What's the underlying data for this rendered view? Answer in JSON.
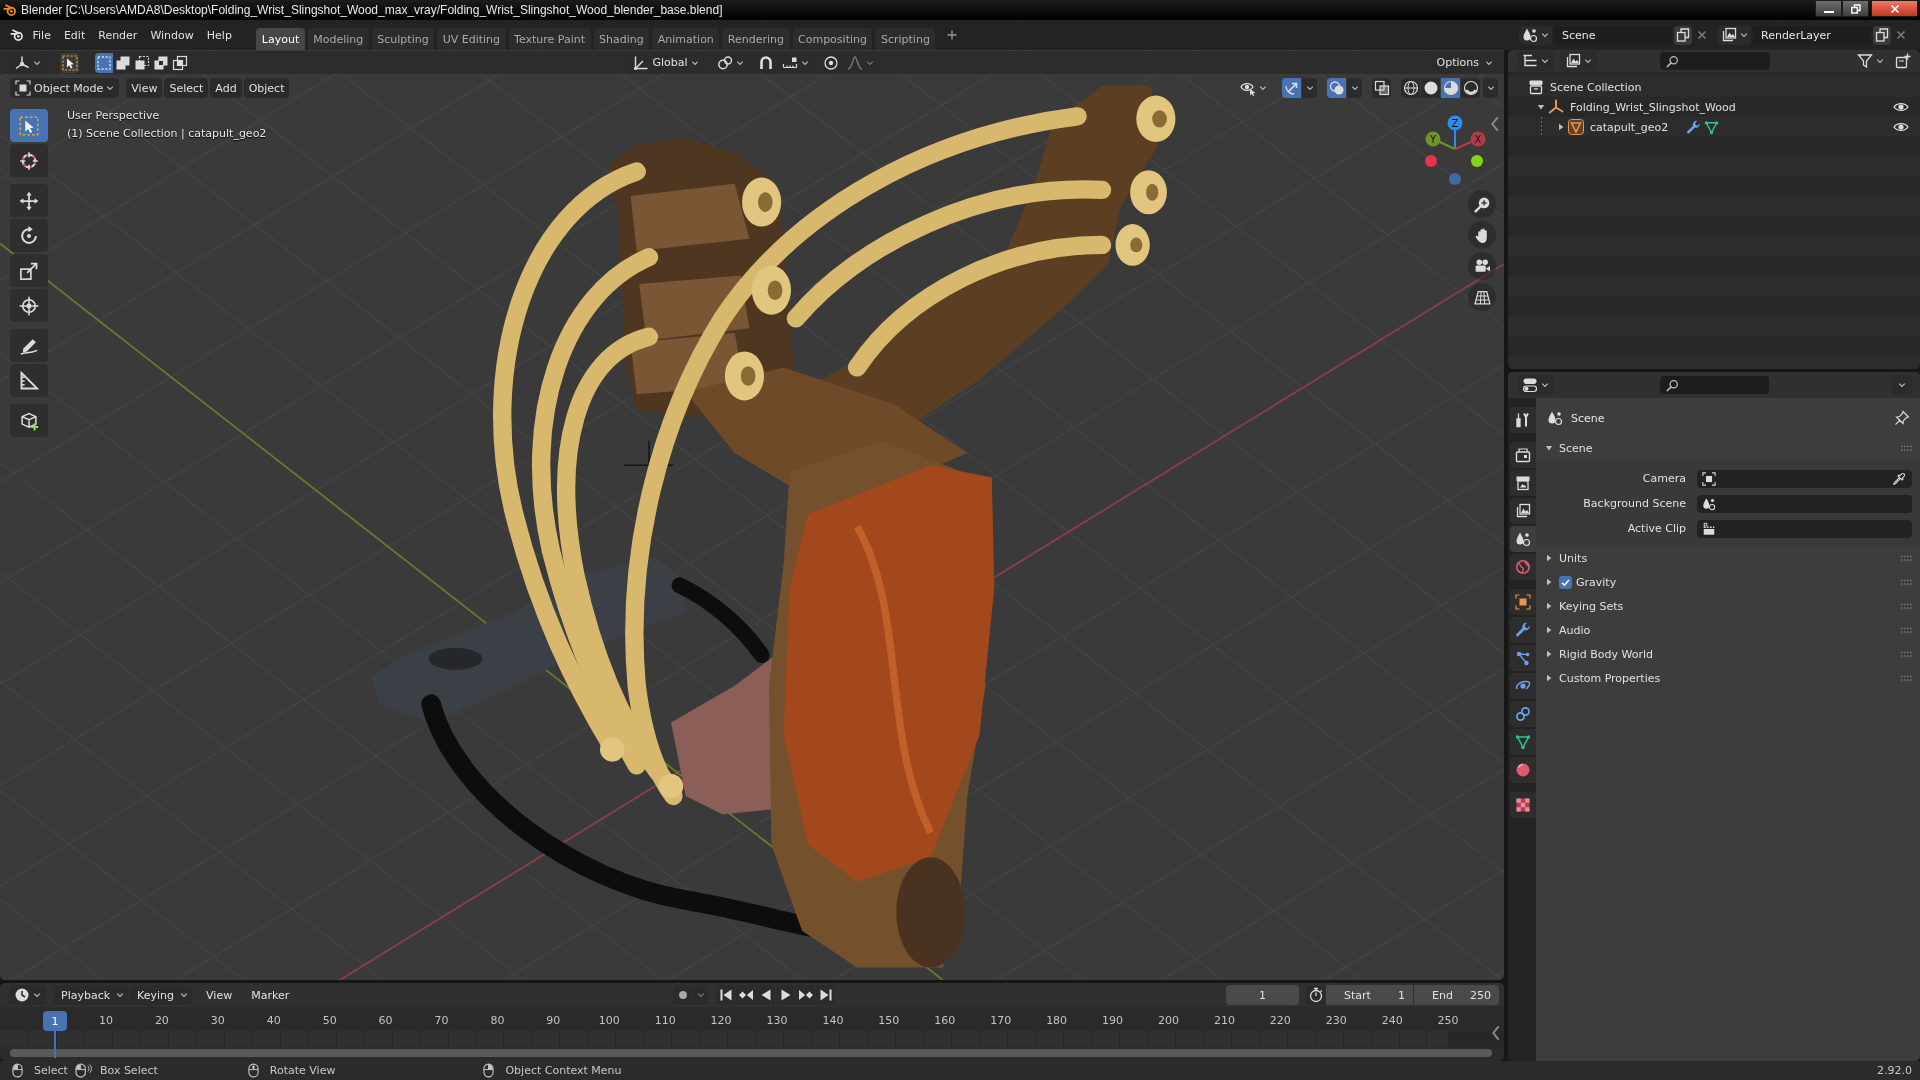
{
  "window": {
    "title": "Blender [C:\\Users\\AMDA8\\Desktop\\Folding_Wrist_Slingshot_Wood_max_vray/Folding_Wrist_Slingshot_Wood_blender_base.blend]"
  },
  "menu": [
    "File",
    "Edit",
    "Render",
    "Window",
    "Help"
  ],
  "workspaces": [
    {
      "label": "Layout",
      "selected": true
    },
    {
      "label": "Modeling",
      "selected": false
    },
    {
      "label": "Sculpting",
      "selected": false
    },
    {
      "label": "UV Editing",
      "selected": false
    },
    {
      "label": "Texture Paint",
      "selected": false
    },
    {
      "label": "Shading",
      "selected": false
    },
    {
      "label": "Animation",
      "selected": false
    },
    {
      "label": "Rendering",
      "selected": false
    },
    {
      "label": "Compositing",
      "selected": false
    },
    {
      "label": "Scripting",
      "selected": false
    }
  ],
  "scene": {
    "value": "Scene"
  },
  "view_layer": {
    "value": "RenderLayer"
  },
  "tool_header": {
    "select_modes": [
      {
        "kind": "set",
        "selected": true
      },
      {
        "kind": "extend",
        "selected": false
      },
      {
        "kind": "subtract",
        "selected": false
      },
      {
        "kind": "difference",
        "selected": false
      },
      {
        "kind": "intersect",
        "selected": false
      }
    ],
    "orientation": "Global",
    "options": "Options"
  },
  "viewport": {
    "mode": "Object Mode",
    "menus": [
      "View",
      "Select",
      "Add",
      "Object"
    ],
    "gizmos_on": true,
    "overlays_on": true,
    "xray_on": false,
    "shading": [
      {
        "kind": "wireframe",
        "selected": false
      },
      {
        "kind": "solid",
        "selected": false
      },
      {
        "kind": "material",
        "selected": true
      },
      {
        "kind": "rendered",
        "selected": false
      }
    ],
    "info": [
      "User Perspective",
      "(1) Scene Collection | catapult_geo2"
    ],
    "tools": [
      [
        {
          "kind": "select",
          "selected": true
        },
        {
          "kind": "cursor",
          "selected": false
        }
      ],
      [
        {
          "kind": "move",
          "selected": false
        },
        {
          "kind": "rotate",
          "selected": false
        },
        {
          "kind": "scale",
          "selected": false
        },
        {
          "kind": "transform",
          "selected": false
        }
      ],
      [
        {
          "kind": "annotate",
          "selected": false
        },
        {
          "kind": "measure",
          "selected": false
        }
      ],
      [
        {
          "kind": "add_cube",
          "selected": false
        }
      ]
    ],
    "axes": [
      {
        "label": "Z",
        "color": "#2c8cf0"
      },
      {
        "label": "Y",
        "color": "#6e9526"
      },
      {
        "label": "X",
        "color": "#b23b4a"
      }
    ],
    "negative_axes": [
      {
        "color": "#ea3250"
      },
      {
        "color": "#80d51a"
      },
      {
        "color": "#3d6ba3"
      }
    ]
  },
  "outliner": {
    "tree": [
      {
        "kind": "collection",
        "label": "Scene Collection",
        "children": [
          {
            "kind": "empty",
            "label": "Folding_Wrist_Slingshot_Wood",
            "expanded": true,
            "visible": true,
            "children": [
              {
                "kind": "mesh",
                "label": "catapult_geo2",
                "expanded": false,
                "visible": true
              }
            ]
          }
        ]
      }
    ]
  },
  "properties": {
    "tabs": [
      [
        {
          "kind": "tool",
          "selected": false
        }
      ],
      [
        {
          "kind": "render",
          "selected": false
        },
        {
          "kind": "output",
          "selected": false
        },
        {
          "kind": "view_layer",
          "selected": false
        },
        {
          "kind": "scene",
          "selected": true
        },
        {
          "kind": "world",
          "selected": false
        }
      ],
      [
        {
          "kind": "object",
          "selected": false
        },
        {
          "kind": "modifiers",
          "selected": false
        },
        {
          "kind": "particles",
          "selected": false
        },
        {
          "kind": "physics",
          "selected": false
        },
        {
          "kind": "constraints",
          "selected": false
        },
        {
          "kind": "data",
          "selected": false
        },
        {
          "kind": "material",
          "selected": false
        }
      ],
      [
        {
          "kind": "texture",
          "selected": false
        }
      ]
    ],
    "context": "Scene",
    "panels": [
      {
        "title": "Scene",
        "expanded": true,
        "fields": [
          {
            "label": "Camera",
            "kind": "camera"
          },
          {
            "label": "Background Scene",
            "kind": "scene"
          },
          {
            "label": "Active Clip",
            "kind": "clip"
          }
        ]
      },
      {
        "title": "Units",
        "expanded": false
      },
      {
        "title": "Gravity",
        "expanded": false,
        "checkbox": {
          "checked": true
        }
      },
      {
        "title": "Keying Sets",
        "expanded": false
      },
      {
        "title": "Audio",
        "expanded": false
      },
      {
        "title": "Rigid Body World",
        "expanded": false
      },
      {
        "title": "Custom Properties",
        "expanded": false
      }
    ]
  },
  "timeline": {
    "menus": [
      {
        "label": "Playback",
        "dropdown": true
      },
      {
        "label": "Keying",
        "dropdown": true
      },
      {
        "label": "View",
        "dropdown": false
      },
      {
        "label": "Marker",
        "dropdown": false
      }
    ],
    "auto_key_on": false,
    "current_frame": "1",
    "preview_range_on": false,
    "start_label": "Start",
    "start": "1",
    "end_label": "End",
    "end": "250",
    "playhead": "1",
    "ruler": [
      "10",
      "20",
      "30",
      "40",
      "50",
      "60",
      "70",
      "80",
      "90",
      "100",
      "110",
      "120",
      "130",
      "140",
      "150",
      "160",
      "170",
      "180",
      "190",
      "200",
      "210",
      "220",
      "230",
      "240",
      "250"
    ]
  },
  "status_bar": {
    "hints": [
      {
        "kind": "left_click",
        "label": "Select"
      },
      {
        "kind": "left_drag",
        "label": "Box Select"
      },
      {
        "kind": "middle_drag",
        "label": "Rotate View"
      },
      {
        "kind": "right_click",
        "label": "Object Context Menu"
      }
    ],
    "version": "2.92.0"
  }
}
